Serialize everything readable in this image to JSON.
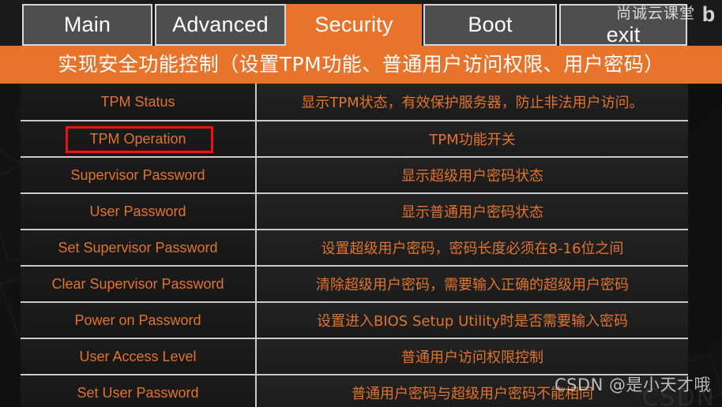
{
  "tabs": [
    {
      "label": "Main",
      "active": false
    },
    {
      "label": "Advanced",
      "active": false
    },
    {
      "label": "Security",
      "active": true
    },
    {
      "label": "Boot",
      "active": false
    },
    {
      "label": "exit",
      "active": false
    }
  ],
  "banner": {
    "title": "实现安全功能控制（设置TPM功能、普通用户访问权限、用户密码）"
  },
  "table": {
    "rows": [
      {
        "setting": "TPM Status",
        "description": "显示TPM状态，有效保护服务器，防止非法用户访问。",
        "highlighted": false
      },
      {
        "setting": "TPM Operation",
        "description": "TPM功能开关",
        "highlighted": true
      },
      {
        "setting": "Supervisor Password",
        "description": "显示超级用户密码状态",
        "highlighted": false
      },
      {
        "setting": "User Password",
        "description": "显示普通用户密码状态",
        "highlighted": false
      },
      {
        "setting": "Set Supervisor Password",
        "description": "设置超级用户密码，密码长度必须在8-16位之间",
        "highlighted": false
      },
      {
        "setting": "Clear Supervisor Password",
        "description": "清除超级用户密码，需要输入正确的超级用户密码",
        "highlighted": false
      },
      {
        "setting": "Power on Password",
        "description": "设置进入BIOS Setup Utility时是否需要输入密码",
        "highlighted": false
      },
      {
        "setting": "User Access Level",
        "description": "普通用户访问权限控制",
        "highlighted": false
      },
      {
        "setting": "Set User Password",
        "description": "普通用户密码与超级用户密码不能相同",
        "highlighted": false
      }
    ]
  },
  "watermarks": {
    "top_right": "尚诚云课堂",
    "top_right_logo": "b",
    "bottom_right": "CSDN @是小天才哦",
    "bottom_ghost": "CSDN"
  },
  "colors": {
    "accent_orange": "#e8732a",
    "text_orange": "#e0732e",
    "highlight_red": "#ee1111",
    "tab_gray": "#4e4e4e",
    "background": "#111111",
    "grid_line": "#c9c9c9"
  }
}
